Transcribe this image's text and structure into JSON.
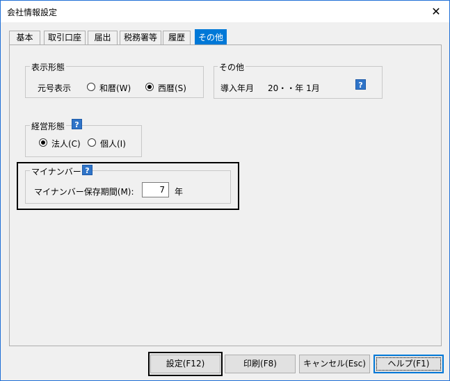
{
  "window": {
    "title": "会社情報設定",
    "close_glyph": "✕"
  },
  "tabs": [
    {
      "label": "基本",
      "active": false
    },
    {
      "label": "取引口座",
      "active": false
    },
    {
      "label": "届出",
      "active": false
    },
    {
      "label": "税務署等",
      "active": false
    },
    {
      "label": "履歴",
      "active": false
    },
    {
      "label": "その他",
      "active": true
    }
  ],
  "display_format": {
    "group_title": "表示形態",
    "era_label": "元号表示",
    "options": [
      {
        "label": "和暦(W)",
        "checked": false
      },
      {
        "label": "西暦(S)",
        "checked": true
      }
    ]
  },
  "other": {
    "group_title": "その他",
    "intro_label": "導入年月",
    "intro_value": "20・・年 1月",
    "help_glyph": "?"
  },
  "management": {
    "group_title": "経営形態",
    "help_glyph": "?",
    "options": [
      {
        "label": "法人(C)",
        "checked": true
      },
      {
        "label": "個人(I)",
        "checked": false
      }
    ]
  },
  "mynumber": {
    "group_title": "マイナンバー",
    "help_glyph": "?",
    "period_label": "マイナンバー保存期間(M):",
    "period_value": "7",
    "unit": "年"
  },
  "buttons": {
    "settings": "設定(F12)",
    "print": "印刷(F8)",
    "cancel": "キャンセル(Esc)",
    "help": "ヘルプ(F1)"
  }
}
